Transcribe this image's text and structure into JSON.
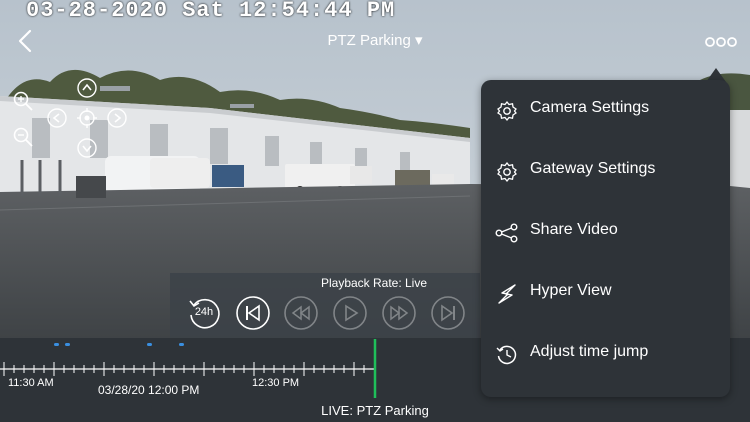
{
  "osd_timestamp": "03-28-2020 Sat 12:54:44 PM",
  "header": {
    "title": "PTZ  Parking ▾",
    "back_icon": "chevron-left-icon",
    "more_icon": "more-options-icon"
  },
  "ptz_controls": [
    "zoom-in-icon",
    "zoom-out-icon",
    "pan-up-icon",
    "pan-down-icon",
    "pan-left-icon",
    "pan-right-icon",
    "ptz-center-icon"
  ],
  "playback": {
    "rate_text": "Playback Rate: Live",
    "rewind_24h_label": "24h",
    "buttons": [
      "rewind-24h",
      "skip-to-start",
      "fast-rewind",
      "play",
      "fast-forward",
      "skip-to-end"
    ]
  },
  "timeline": {
    "labels": [
      "11:30 AM",
      "12:30 PM"
    ],
    "current_date_label": "03/28/20 12:00 PM",
    "live_label": "LIVE: PTZ  Parking",
    "colors": {
      "playhead": "#1fbf5a",
      "event_marker": "#3a8fe0"
    }
  },
  "menu": {
    "items": [
      {
        "label": "Camera Settings",
        "icon": "gear-icon"
      },
      {
        "label": "Gateway Settings",
        "icon": "gear-icon"
      },
      {
        "label": "Share Video",
        "icon": "share-icon"
      },
      {
        "label": "Hyper View",
        "icon": "lightning-icon"
      },
      {
        "label": "Adjust time jump",
        "icon": "history-clock-icon"
      }
    ]
  }
}
